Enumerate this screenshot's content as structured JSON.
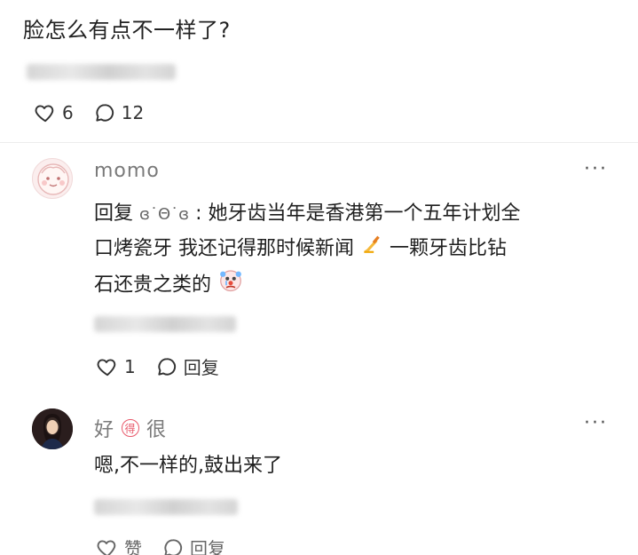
{
  "post": {
    "text": "脸怎么有点不一样了?",
    "like_count": "6",
    "comment_count": "12"
  },
  "comments": [
    {
      "username": "momo",
      "more": "···",
      "reply_prefix": "回复",
      "reply_to": "ɞ˙Θ˙ɞ",
      "colon": ":",
      "line1": "她牙齿当年是香港第一个五年计划全",
      "line2a": "口烤瓷牙 我还记得那时候新闻",
      "line2b": "一颗牙齿比钻",
      "line3": "石还贵之类的",
      "like_count": "1",
      "reply_label": "回复"
    },
    {
      "username_a": "好",
      "username_badge": "得",
      "username_b": "很",
      "more": "···",
      "text": "嗯,不一样的,鼓出来了",
      "like_label": "赞",
      "reply_label": "回复"
    }
  ],
  "colors": {
    "text": "#1f1f1f",
    "username": "#7a7a7a",
    "badge": "#e8586a"
  }
}
